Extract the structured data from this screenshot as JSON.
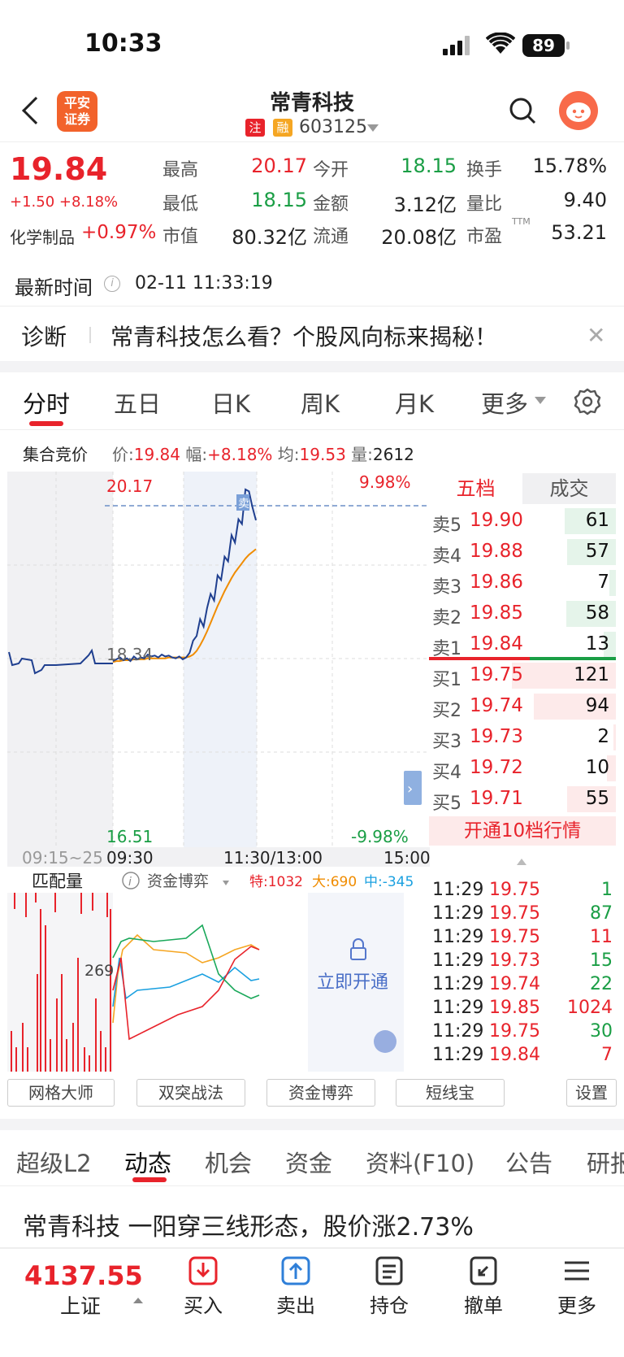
{
  "status_bar": {
    "time": "10:33",
    "battery": "89"
  },
  "header": {
    "logo_text": "平安\n证券",
    "stock_name": "常青科技",
    "tag_zhu": "注",
    "tag_rong": "融",
    "stock_code": "603125"
  },
  "quote": {
    "price": "19.84",
    "change": "+1.50 +8.18%",
    "industry_name": "化学制品",
    "industry_change": "+0.97%",
    "fields": [
      {
        "label": "最高",
        "value": "20.17",
        "color": "#e8232b"
      },
      {
        "label": "今开",
        "value": "18.15",
        "color": "#1a9e45"
      },
      {
        "label": "换手",
        "value": "15.78%",
        "color": "#222"
      },
      {
        "label": "最低",
        "value": "18.15",
        "color": "#1a9e45"
      },
      {
        "label": "金额",
        "value": "3.12亿",
        "color": "#222"
      },
      {
        "label": "量比",
        "value": "9.40",
        "color": "#222"
      },
      {
        "label": "市值",
        "value": "80.32亿",
        "color": "#222"
      },
      {
        "label": "流通",
        "value": "20.08亿",
        "color": "#222"
      },
      {
        "label": "市盈",
        "value": "53.21",
        "color": "#222",
        "sup": "TTM"
      }
    ]
  },
  "update": {
    "label": "最新时间",
    "info_icon": "i",
    "time": "02-11 11:33:19"
  },
  "diagnosis": {
    "label": "诊断",
    "text": "常青科技怎么看？个股风向标来揭秘！",
    "close": "✕"
  },
  "chart_tabs": [
    "分时",
    "五日",
    "日K",
    "周K",
    "月K",
    "更多"
  ],
  "auction": {
    "label": "集合竞价",
    "price_label": "价:",
    "price": "19.84",
    "amp_label": "幅:",
    "amp": "+8.18%",
    "avg_label": "均:",
    "avg": "19.53",
    "vol_label": "量:",
    "vol": "2612"
  },
  "chart": {
    "high_label": "20.17",
    "high_pct": "9.98%",
    "pre_close": "18.34",
    "low_label": "16.51",
    "low_pct": "-9.98%",
    "sell_marker": "卖",
    "t_pre": "09:15~25",
    "t_open": "09:30",
    "t_mid": "11:30/13:00",
    "t_close": "15:00",
    "match_label": "匹配量",
    "lower_axis": "269",
    "fund_label": "资金博弈",
    "fund_te": "特:1032",
    "fund_da": "大:690",
    "fund_zhong": "中:-345",
    "unlock": "立即开通"
  },
  "chart_data": {
    "type": "line",
    "x": [
      "09:30",
      "11:30/13:00",
      "15:00"
    ],
    "ylim": [
      16.51,
      20.17
    ],
    "pre_close": 18.34,
    "series": [
      {
        "name": "price",
        "color": "#1f3f8f",
        "values": [
          18.33,
          18.35,
          18.37,
          18.34,
          18.36,
          18.33,
          18.38,
          18.35,
          18.37,
          18.36,
          18.4,
          18.38,
          18.39,
          18.37,
          18.4,
          18.38,
          18.39,
          18.37,
          18.36,
          18.38,
          18.35,
          18.37,
          18.42,
          18.55,
          18.6,
          18.78,
          18.7,
          18.9,
          19.05,
          18.98,
          19.25,
          19.2,
          19.45,
          19.4,
          19.68,
          19.6,
          19.85,
          19.8,
          20.17,
          20.15,
          19.98,
          19.84
        ]
      },
      {
        "name": "avg",
        "color": "#f08c00",
        "values": [
          18.32,
          18.33,
          18.33,
          18.34,
          18.34,
          18.34,
          18.35,
          18.35,
          18.35,
          18.35,
          18.36,
          18.36,
          18.36,
          18.36,
          18.36,
          18.36,
          18.37,
          18.37,
          18.37,
          18.37,
          18.37,
          18.37,
          18.38,
          18.4,
          18.44,
          18.5,
          18.57,
          18.65,
          18.74,
          18.83,
          18.92,
          19.0,
          19.08,
          19.15,
          19.22,
          19.28,
          19.33,
          19.38,
          19.43,
          19.47,
          19.5,
          19.53
        ]
      }
    ]
  },
  "order_book": {
    "tab_five": "五档",
    "tab_deals": "成交",
    "asks": [
      {
        "label": "卖5",
        "price": "19.90",
        "vol": "61",
        "bar": 0.42
      },
      {
        "label": "卖4",
        "price": "19.88",
        "vol": "57",
        "bar": 0.4
      },
      {
        "label": "卖3",
        "price": "19.86",
        "vol": "7",
        "bar": 0.05
      },
      {
        "label": "卖2",
        "price": "19.85",
        "vol": "58",
        "bar": 0.41
      },
      {
        "label": "卖1",
        "price": "19.84",
        "vol": "13",
        "bar": 0.1
      }
    ],
    "bids": [
      {
        "label": "买1",
        "price": "19.75",
        "vol": "121",
        "bar": 0.85
      },
      {
        "label": "买2",
        "price": "19.74",
        "vol": "94",
        "bar": 0.67
      },
      {
        "label": "买3",
        "price": "19.73",
        "vol": "2",
        "bar": 0.02
      },
      {
        "label": "买4",
        "price": "19.72",
        "vol": "10",
        "bar": 0.07
      },
      {
        "label": "买5",
        "price": "19.71",
        "vol": "55",
        "bar": 0.4
      }
    ],
    "open10": "开通10档行情"
  },
  "ticks": [
    {
      "time": "11:29",
      "price": "19.75",
      "vol": "1",
      "c": "#1a9e45"
    },
    {
      "time": "11:29",
      "price": "19.75",
      "vol": "87",
      "c": "#1a9e45"
    },
    {
      "time": "11:29",
      "price": "19.75",
      "vol": "11",
      "c": "#e8232b"
    },
    {
      "time": "11:29",
      "price": "19.73",
      "vol": "15",
      "c": "#1a9e45"
    },
    {
      "time": "11:29",
      "price": "19.74",
      "vol": "22",
      "c": "#1a9e45"
    },
    {
      "time": "11:29",
      "price": "19.85",
      "vol": "1024",
      "c": "#e8232b"
    },
    {
      "time": "11:29",
      "price": "19.75",
      "vol": "30",
      "c": "#1a9e45"
    },
    {
      "time": "11:29",
      "price": "19.84",
      "vol": "7",
      "c": "#e8232b"
    }
  ],
  "tools": [
    "网格大师",
    "双突战法",
    "资金博弈",
    "短线宝",
    "设置"
  ],
  "news_tabs": [
    "超级L2",
    "动态",
    "机会",
    "资金",
    "资料(F10)",
    "公告",
    "研报"
  ],
  "news_headline": "常青科技 一阳穿三线形态，股价涨2.73%",
  "bottom": {
    "index_value": "4137.55",
    "index_name": "上证",
    "buttons": [
      "买入",
      "卖出",
      "持仓",
      "撤单",
      "更多"
    ]
  }
}
